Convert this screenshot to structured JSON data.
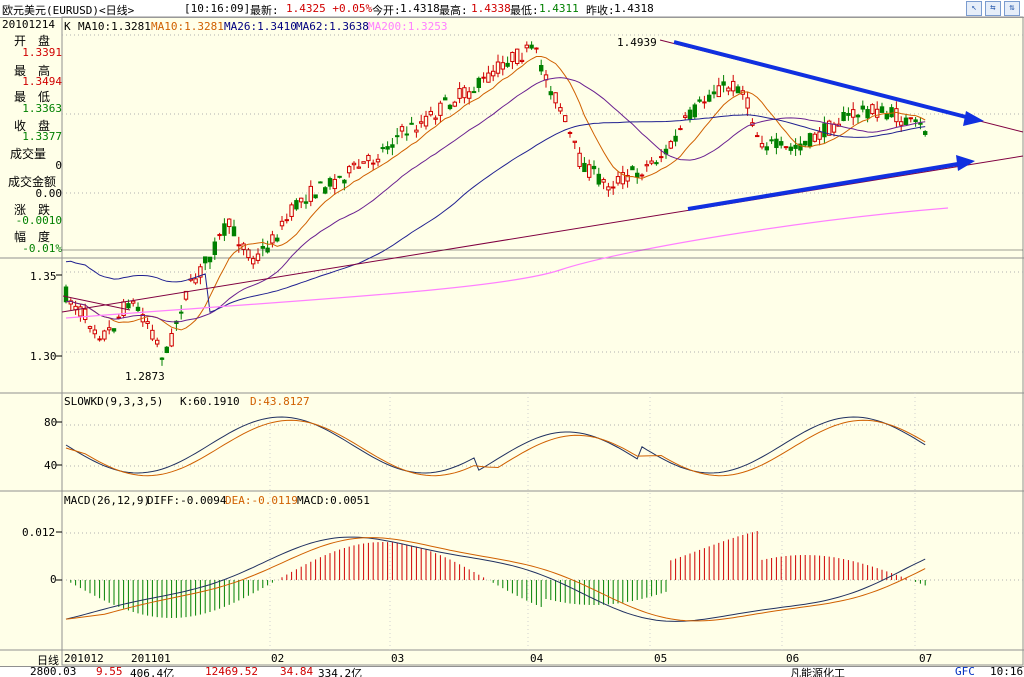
{
  "header": {
    "title": "欧元美元(EURUSD)<日线>",
    "time": "[10:16:09]",
    "latest_label": "最新:",
    "latest_value": "1.4325 +0.05%",
    "open_today_label": "今开:",
    "open_today_value": "1.4318",
    "high_label": "最高:",
    "high_value": "1.4338",
    "low_label": "最低:",
    "low_value": "1.4311",
    "prev_close_label": "昨收:",
    "prev_close_value": "1.4318",
    "window_buttons": [
      "↖",
      "⇆",
      "⇅"
    ]
  },
  "info_panel": {
    "date": "20101214",
    "rows": [
      {
        "label": "开　盘",
        "value": "1.3391"
      },
      {
        "label": "最　高",
        "value": "1.3494"
      },
      {
        "label": "最　低",
        "value": "1.3363"
      },
      {
        "label": "收　盘",
        "value": "1.3377"
      },
      {
        "label": "成交量",
        "value": "0"
      },
      {
        "label": "成交金额",
        "value": "0.00"
      },
      {
        "label": "涨　跌",
        "value": "-0.0010"
      },
      {
        "label": "幅　度",
        "value": "-0.01%"
      }
    ]
  },
  "price_panel": {
    "legend_k": "K",
    "ma": [
      {
        "text": "MA10:1.3281",
        "color": "#000000"
      },
      {
        "text": "MA10:1.3281",
        "color": "#d06000"
      },
      {
        "text": "MA26:1.3410",
        "color": "#000080"
      },
      {
        "text": "MA62:1.3638",
        "color": "#000080"
      },
      {
        "text": "MA200:1.3253",
        "color": "#ff80ff"
      }
    ],
    "y_ticks": [
      "1.35",
      "1.30"
    ],
    "high_annotation": "1.4939",
    "low_annotation": "1.2873"
  },
  "kd_panel": {
    "title": "SLOWKD(9,3,3,5)",
    "k_text": "K:60.1910",
    "d_text": "D:43.8127",
    "y_ticks": [
      "80",
      "40"
    ]
  },
  "macd_panel": {
    "title": "MACD(26,12,9)",
    "diff_text": "DIFF:-0.0094",
    "dea_text": "DEA:-0.0119",
    "macd_text": "MACD:0.0051",
    "y_ticks": [
      "0.012",
      "0"
    ]
  },
  "x_axis": {
    "period_label": "日线",
    "labels": [
      "201012",
      "201101",
      "02",
      "03",
      "04",
      "05",
      "06",
      "07"
    ]
  },
  "status_bar": {
    "items": [
      "2800.03",
      "9.55",
      "406.4亿",
      "12469.52",
      "34.84",
      "334.2亿",
      "凡能源化工",
      "GFC",
      "10:16"
    ]
  },
  "colors": {
    "up": "#d00000",
    "down": "#008000",
    "ma_orange": "#d06000",
    "ma_navy": "#202090",
    "ma_pink": "#ff80ff",
    "trend_purple": "#800040",
    "arrow_blue": "#1030e0"
  }
}
